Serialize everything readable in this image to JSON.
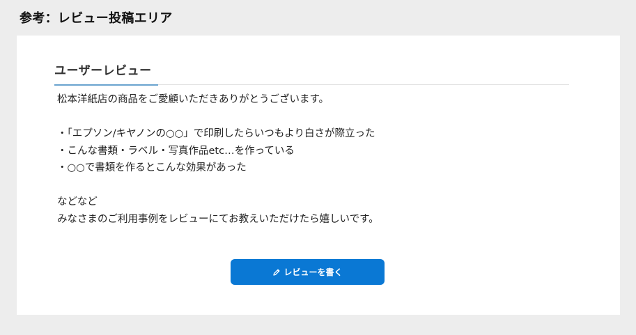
{
  "page": {
    "heading": "参考：レビュー投稿エリア"
  },
  "review_section": {
    "title": "ユーザーレビュー",
    "intro": "松本洋紙店の商品をご愛顧いただきありがとうございます。",
    "bullets": [
      "・「エプソン/キヤノンの○○」で印刷したらいつもより白さが際立った",
      "・こんな書類・ラベル・写真作品etc…を作っている",
      "・○○で書類を作るとこんな効果があった"
    ],
    "closing_1": "などなど",
    "closing_2": "みなさまのご利用事例をレビューにてお教えいただけたら嬉しいです。",
    "write_button_label": "レビューを書く",
    "write_button_icon": "pencil-icon"
  },
  "colors": {
    "background": "#ededed",
    "card": "#ffffff",
    "accent_line": "#6aa3cf",
    "button": "#0a78d4",
    "button_text": "#ffffff"
  }
}
